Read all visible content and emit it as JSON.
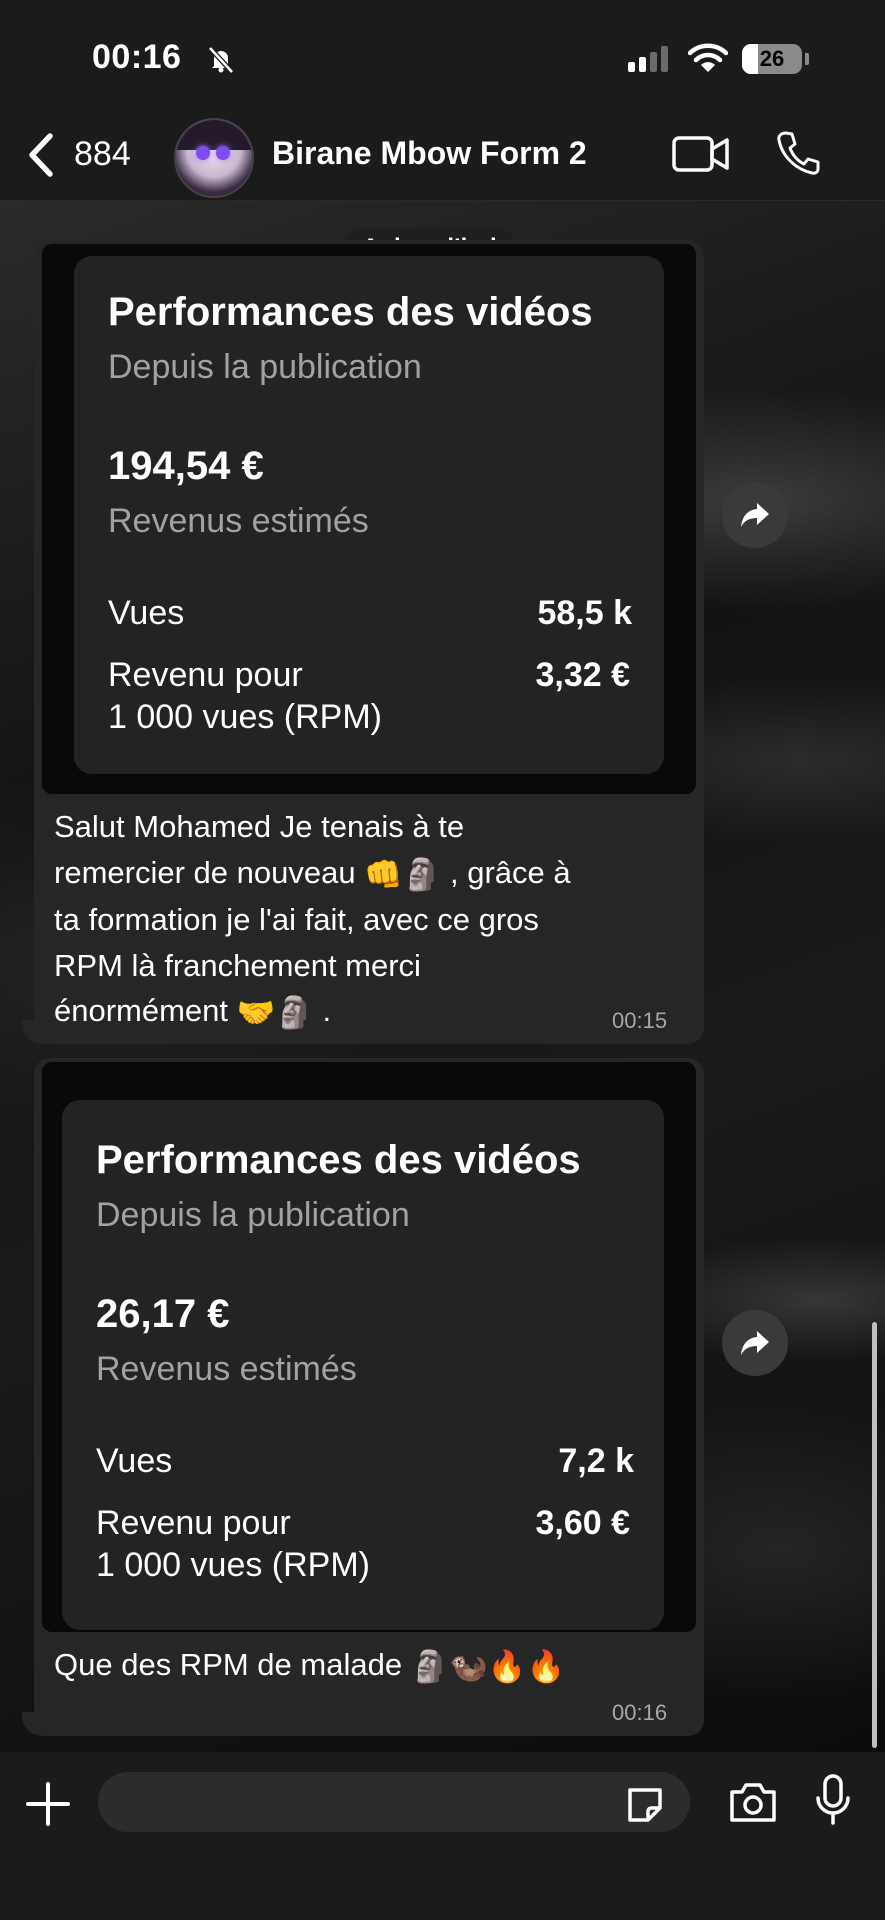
{
  "status_bar": {
    "time": "00:16",
    "battery": "26",
    "battery_level": 0.26
  },
  "header": {
    "back_count": "884",
    "contact_name": "Birane Mbow Form 2"
  },
  "date_separator": "Aujourd’hui",
  "messages": [
    {
      "card": {
        "title": "Performances des vidéos",
        "subtitle": "Depuis la publication",
        "amount": "194,54 €",
        "amount_label": "Revenus estimés",
        "views_label": "Vues",
        "views_value": "58,5 k",
        "rpm_label_1": "Revenu pour",
        "rpm_label_2": "1 000 vues (RPM)",
        "rpm_value": "3,32 €"
      },
      "lines": [
        "Salut Mohamed Je tenais à te",
        "remercier de nouveau",
        ", grâce à",
        "ta formation je l'ai fait, avec ce gros",
        "RPM là franchement merci",
        "énormément",
        "."
      ],
      "emojis_1": "👊🗿",
      "emojis_2": "🤝🗿",
      "time": "00:15"
    },
    {
      "card": {
        "title": "Performances des vidéos",
        "subtitle": "Depuis la publication",
        "amount": "26,17 €",
        "amount_label": "Revenus estimés",
        "views_label": "Vues",
        "views_value": "7,2 k",
        "rpm_label_1": "Revenu pour",
        "rpm_label_2": "1 000 vues (RPM)",
        "rpm_value": "3,60 €"
      },
      "text": "Que des RPM de malade",
      "emojis": "🗿🦦🔥🔥",
      "time": "00:16"
    }
  ],
  "input": {
    "placeholder": ""
  },
  "icons": [
    "bell-off-icon",
    "signal-icon",
    "wifi-icon",
    "battery-icon",
    "back-chevron-icon",
    "video-call-icon",
    "phone-call-icon",
    "forward-icon",
    "plus-icon",
    "sticker-icon",
    "camera-icon",
    "microphone-icon"
  ]
}
